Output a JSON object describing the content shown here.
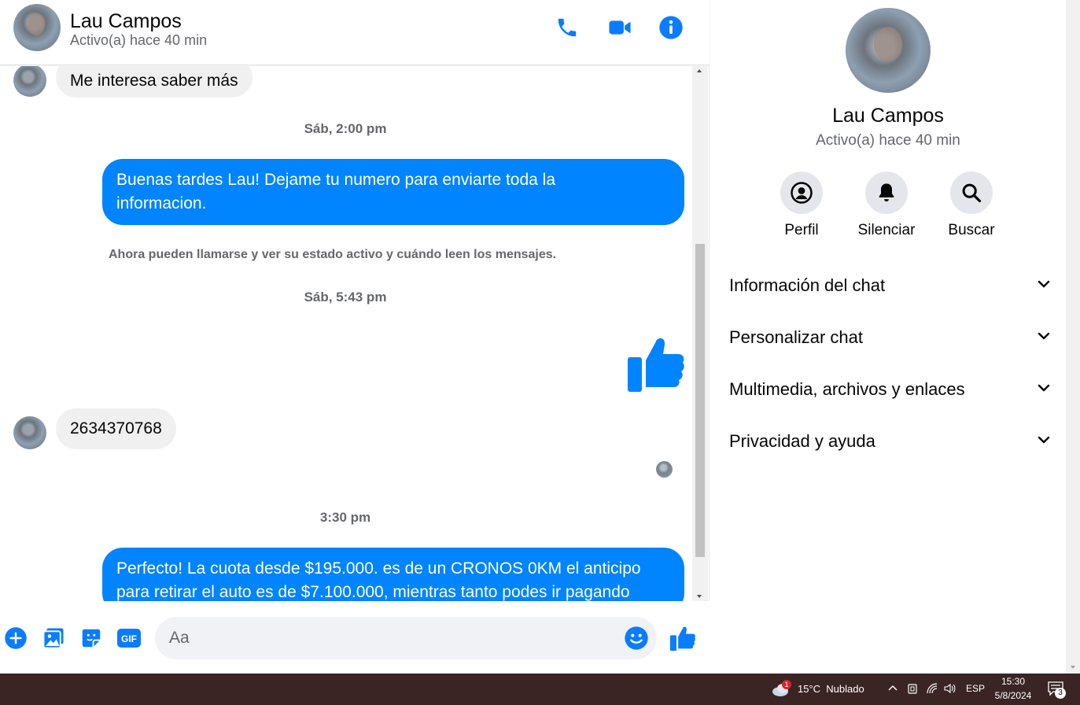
{
  "contact": {
    "name": "Lau Campos",
    "status": "Activo(a) hace 40 min"
  },
  "header_icons": [
    "phone-icon",
    "video-camera-icon",
    "info-icon"
  ],
  "accent_color": "#0084ff",
  "messages": {
    "m1": "Me interesa saber más",
    "ts1": "Sáb, 2:00 pm",
    "m2_line1": "Buenas tardes Lau! Dejame tu numero para enviarte toda la",
    "m2_line2": "informacion.",
    "system": "Ahora pueden llamarse y ver su estado activo y cuándo leen los mensajes.",
    "ts2": "Sáb, 5:43 pm",
    "m3_like": "like-icon",
    "m4": "2634370768",
    "ts3": "3:30 pm",
    "m5_line1": "Perfecto! La cuota desde $195.000. es de un CRONOS 0KM el anticipo",
    "m5_line2": "para retirar el auto es de $7.100.000, mientras tanto podes ir pagando"
  },
  "composer": {
    "placeholder": "Aa",
    "icons": [
      "plus-icon",
      "gallery-icon",
      "sticker-icon",
      "gif-icon",
      "emoji-icon",
      "like-icon"
    ],
    "gif_label": "GIF"
  },
  "info_panel": {
    "name": "Lau Campos",
    "status": "Activo(a) hace 40 min",
    "actions": [
      {
        "label": "Perfil",
        "icon": "profile-icon"
      },
      {
        "label": "Silenciar",
        "icon": "bell-icon"
      },
      {
        "label": "Buscar",
        "icon": "search-icon"
      }
    ],
    "sections": [
      "Información del chat",
      "Personalizar chat",
      "Multimedia, archivos y enlaces",
      "Privacidad y ayuda"
    ]
  },
  "taskbar": {
    "weather": "15°C  Nublado",
    "weather_badge": "1",
    "language": "ESP",
    "time": "15:30",
    "date": "5/8/2024",
    "notifications": "3"
  }
}
